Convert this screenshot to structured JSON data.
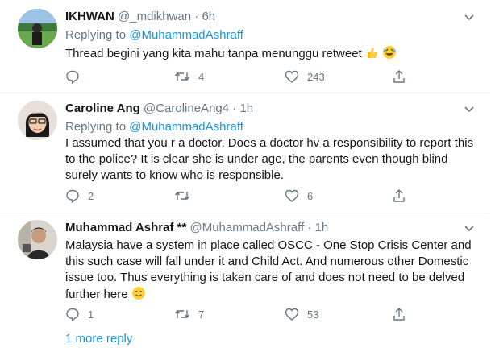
{
  "tweets": [
    {
      "name": "IKHWAN",
      "handle": "@_mdikhwan",
      "dot": "·",
      "time": "6h",
      "replying_prefix": "Replying to",
      "replying_to": "@MuhammadAshraff",
      "text": "Thread begini yang kita mahu tanpa menunggu retweet",
      "emojis": [
        "thumbs-up-emoji",
        "rolling-laughing-emoji"
      ],
      "replies": "",
      "retweets": "4",
      "likes": "243"
    },
    {
      "name": "Caroline Ang",
      "handle": "@CarolineAng4",
      "dot": "·",
      "time": "1h",
      "replying_prefix": "Replying to",
      "replying_to": "@MuhammadAshraff",
      "text_lines": [
        "I assumed that you r a doctor. Does a doctor hv a responsibility to report this",
        "to the police? It is clear she is under age, the parents even though blind",
        "surely wants to know who is responsible."
      ],
      "replies": "2",
      "retweets": "",
      "likes": "6"
    },
    {
      "name": "Muhammad Ashraf **",
      "handle": "@MuhammadAshraff",
      "dot": "·",
      "time": "1h",
      "text_lines": [
        "Malaysia have a system in place called OSCC - One Stop Crisis Center and",
        "this such case will fall under it and Child Act. And numerous other Domestic",
        "issue too. Thus everything is taken care of and does not need to be delved",
        "further here"
      ],
      "emoji": "slightly-smiling-emoji",
      "replies": "1",
      "retweets": "7",
      "likes": "53"
    }
  ],
  "more_replies": "1 more reply",
  "colors": {
    "text": "#14171a",
    "secondary": "#657786",
    "link": "#1b95e0",
    "divider": "#e6ecf0"
  }
}
